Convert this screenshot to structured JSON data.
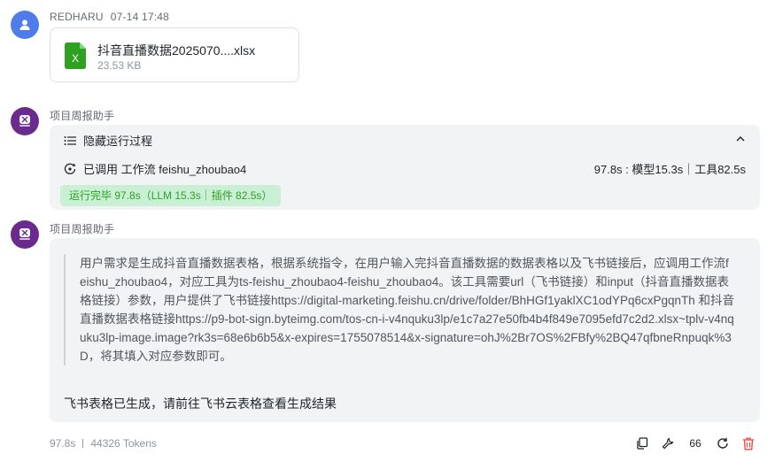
{
  "user_message": {
    "sender": "REDHARU",
    "time": "07-14 17:48",
    "file": {
      "name": "抖音直播数据2025070....xlsx",
      "size": "23.53 KB",
      "icon": "excel-file-icon",
      "icon_color": "#2ea121"
    }
  },
  "bot_run": {
    "sender": "项目周报助手",
    "toggle_label": "隐藏运行过程",
    "step_label": "已调用 工作流 feishu_zhoubao4",
    "step_stats": "97.8s : 模型15.3s｜工具82.5s",
    "status_badge": "运行完毕 97.8s（LLM 15.3s｜插件 82.5s）"
  },
  "bot_answer": {
    "sender": "项目周报助手",
    "quote": "用户需求是生成抖音直播数据表格，根据系统指令，在用户输入完抖音直播数据的数据表格以及飞书链接后，应调用工作流feishu_zhoubao4，对应工具为ts-feishu_zhoubao4-feishu_zhoubao4。该工具需要url（飞书链接）和input（抖音直播数据表格链接）参数，用户提供了飞书链接https://digital-marketing.feishu.cn/drive/folder/BhHGf1yaklXC1odYPq6cxPgqnTh 和抖音直播数据表格链接https://p9-bot-sign.byteimg.com/tos-cn-i-v4nquku3lp/e1c7a27e50fb4b4f849e7095efd7c2d2.xlsx~tplv-v4nquku3lp-image.image?rk3s=68e6b6b5&x-expires=1755078514&x-signature=ohJ%2Br7OS%2FBfy%2BQ47qfbneRnpuqk%3D，将其填入对应参数即可。",
    "final_text": "飞书表格已生成，请前往飞书云表格查看生成结果"
  },
  "footer": {
    "duration": "97.8s",
    "tokens": "44326 Tokens",
    "quote_count": "66",
    "delete_color": "#f54a45"
  },
  "colors": {
    "accent": "#4e7de9",
    "bot_avatar": "#6b2a8e",
    "success": "#2ea121"
  }
}
